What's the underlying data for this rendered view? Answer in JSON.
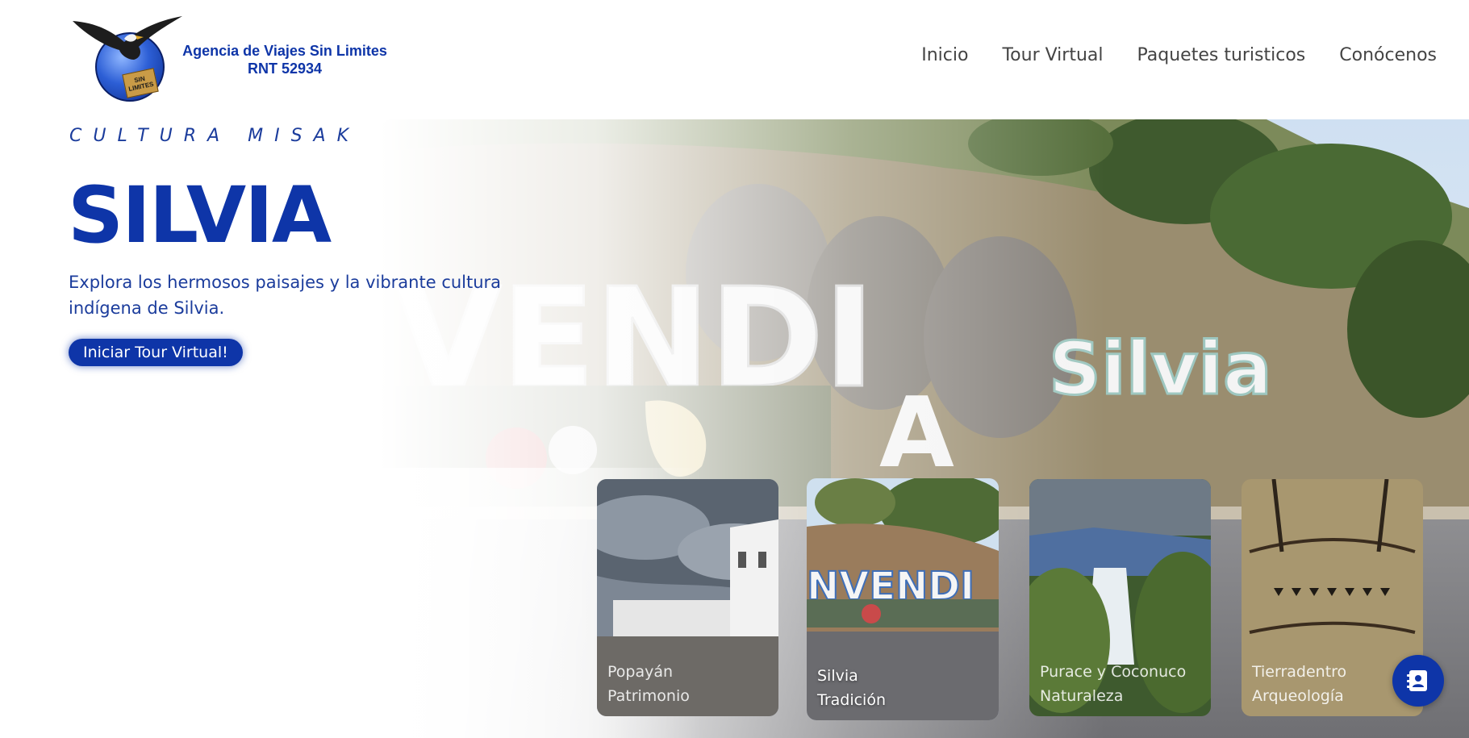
{
  "logo": {
    "line1": "Agencia de Viajes Sin Limites",
    "line2": "RNT 52934",
    "tag_line1": "SIN",
    "tag_line2": "LIMITES"
  },
  "nav": {
    "items": [
      {
        "label": "Inicio"
      },
      {
        "label": "Tour Virtual"
      },
      {
        "label": "Paquetes turisticos"
      },
      {
        "label": "Conócenos"
      }
    ]
  },
  "hero": {
    "kicker": "CULTURA MISAK",
    "title": "SILVIA",
    "subtitle": "Explora los hermosos paisajes y la vibrante cultura indígena de Silvia.",
    "cta_label": "Iniciar Tour Virtual!"
  },
  "cards": [
    {
      "line1": "Popayán",
      "line2": "Patrimonio"
    },
    {
      "line1": "Silvia",
      "line2": "Tradición"
    },
    {
      "line1": "Purace y Coconuco",
      "line2": "Naturaleza"
    },
    {
      "line1": "Tierradentro",
      "line2": "Arqueología"
    }
  ],
  "colors": {
    "brand_blue": "#0e35a8",
    "text_blue": "#1b3c9c",
    "nav_text": "#444444"
  },
  "icons": {
    "contact": "contact-book-icon"
  }
}
